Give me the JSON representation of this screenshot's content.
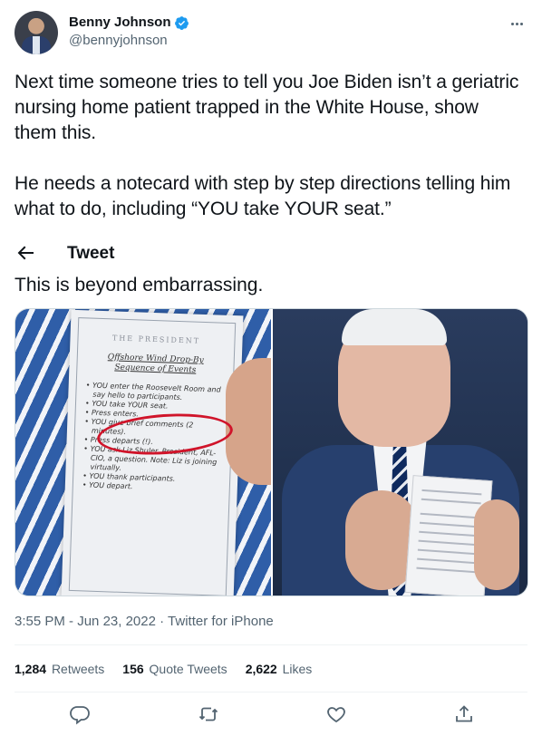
{
  "author": {
    "display_name": "Benny Johnson",
    "handle": "@bennyjohnson",
    "verified": true,
    "verified_color": "#1d9bf0"
  },
  "tweet": {
    "text": "Next time someone tries to tell you Joe Biden isn’t a geriatric nursing home patient trapped in the White House, show them this.\n\nHe needs a notecard with step by step directions telling him what to do, including “YOU take YOUR seat.”"
  },
  "overlay": {
    "back_icon": "arrow-left-icon",
    "title": "Tweet"
  },
  "quote_text": "This is beyond embarrassing.",
  "media": {
    "left_card": {
      "heading": "THE PRESIDENT",
      "title": "Offshore Wind Drop-By Sequence of Events",
      "lines": [
        "YOU enter the Roosevelt Room and say hello to participants.",
        "YOU take YOUR seat.",
        "Press enters.",
        "YOU give brief comments (2 minutes).",
        "Press departs (!).",
        "YOU ask Liz Shuler, President, AFL-CIO, a question. Note: Liz is joining virtually.",
        "YOU thank participants.",
        "YOU depart."
      ],
      "highlight_color": "#d0142a"
    }
  },
  "meta": {
    "time": "3:55 PM",
    "date": "Jun 23, 2022",
    "source": "Twitter for iPhone",
    "separator": "·"
  },
  "stats": {
    "retweets_count": "1,284",
    "retweets_label": "Retweets",
    "quotes_count": "156",
    "quotes_label": "Quote Tweets",
    "likes_count": "2,622",
    "likes_label": "Likes"
  },
  "actions": [
    "reply-icon",
    "retweet-icon",
    "like-icon",
    "share-icon"
  ],
  "colors": {
    "text": "#0f1419",
    "secondary": "#536471",
    "divider": "#eff3f4"
  }
}
